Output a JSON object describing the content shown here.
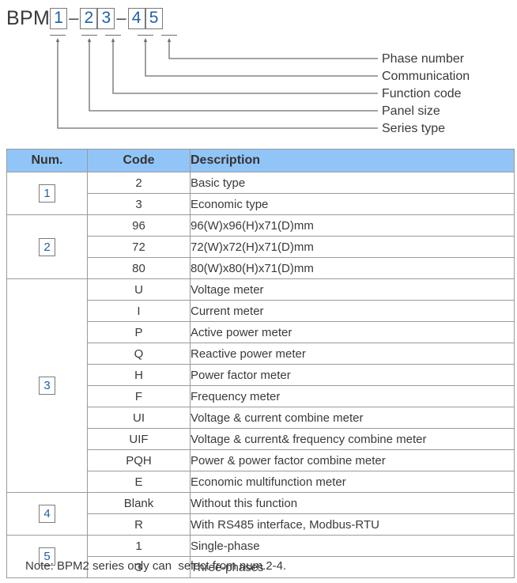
{
  "diagram": {
    "prefix": "BPM",
    "separator": "–",
    "segments": [
      {
        "digit": "1",
        "label": "Series type"
      },
      {
        "digit": "2",
        "label": "Panel size"
      },
      {
        "digit": "3",
        "label": "Function code"
      },
      {
        "digit": "4",
        "label": "Communication"
      },
      {
        "digit": "5",
        "label": "Phase number"
      }
    ],
    "labels_top_to_bottom": [
      "Phase number",
      "Communication",
      "Function code",
      "Panel size",
      "Series type"
    ]
  },
  "table": {
    "headers": {
      "num": "Num.",
      "code": "Code",
      "description": "Description"
    },
    "groups": [
      {
        "num": "1",
        "rows": [
          {
            "code": "2",
            "description": "Basic type"
          },
          {
            "code": "3",
            "description": "Economic type"
          }
        ]
      },
      {
        "num": "2",
        "rows": [
          {
            "code": "96",
            "description": "96(W)x96(H)x71(D)mm"
          },
          {
            "code": "72",
            "description": "72(W)x72(H)x71(D)mm"
          },
          {
            "code": "80",
            "description": "80(W)x80(H)x71(D)mm"
          }
        ]
      },
      {
        "num": "3",
        "rows": [
          {
            "code": "U",
            "description": "Voltage meter"
          },
          {
            "code": "I",
            "description": "Current meter"
          },
          {
            "code": "P",
            "description": "Active power meter"
          },
          {
            "code": "Q",
            "description": "Reactive power meter"
          },
          {
            "code": "H",
            "description": "Power factor meter"
          },
          {
            "code": "F",
            "description": "Frequency meter"
          },
          {
            "code": "UI",
            "description": "Voltage & current combine meter"
          },
          {
            "code": "UIF",
            "description": "Voltage & current& frequency combine meter"
          },
          {
            "code": "PQH",
            "description": "Power & power factor combine meter"
          },
          {
            "code": "E",
            "description": "Economic multifunction meter"
          }
        ]
      },
      {
        "num": "4",
        "rows": [
          {
            "code": "Blank",
            "description": "Without this function"
          },
          {
            "code": "R",
            "description": "With RS485 interface, Modbus-RTU"
          }
        ]
      },
      {
        "num": "5",
        "rows": [
          {
            "code": "1",
            "description": "Single-phase"
          },
          {
            "code": "3",
            "description": "Three-phases"
          }
        ]
      }
    ]
  },
  "note": "Note: BPM2 series only can  select from num.2-4.",
  "colors": {
    "header_fill": "#92c5f7",
    "code_blue": "#1f5fa9",
    "text": "#3a3a3a",
    "border": "#9a9a9a",
    "leader_line": "#6e6e6e"
  }
}
